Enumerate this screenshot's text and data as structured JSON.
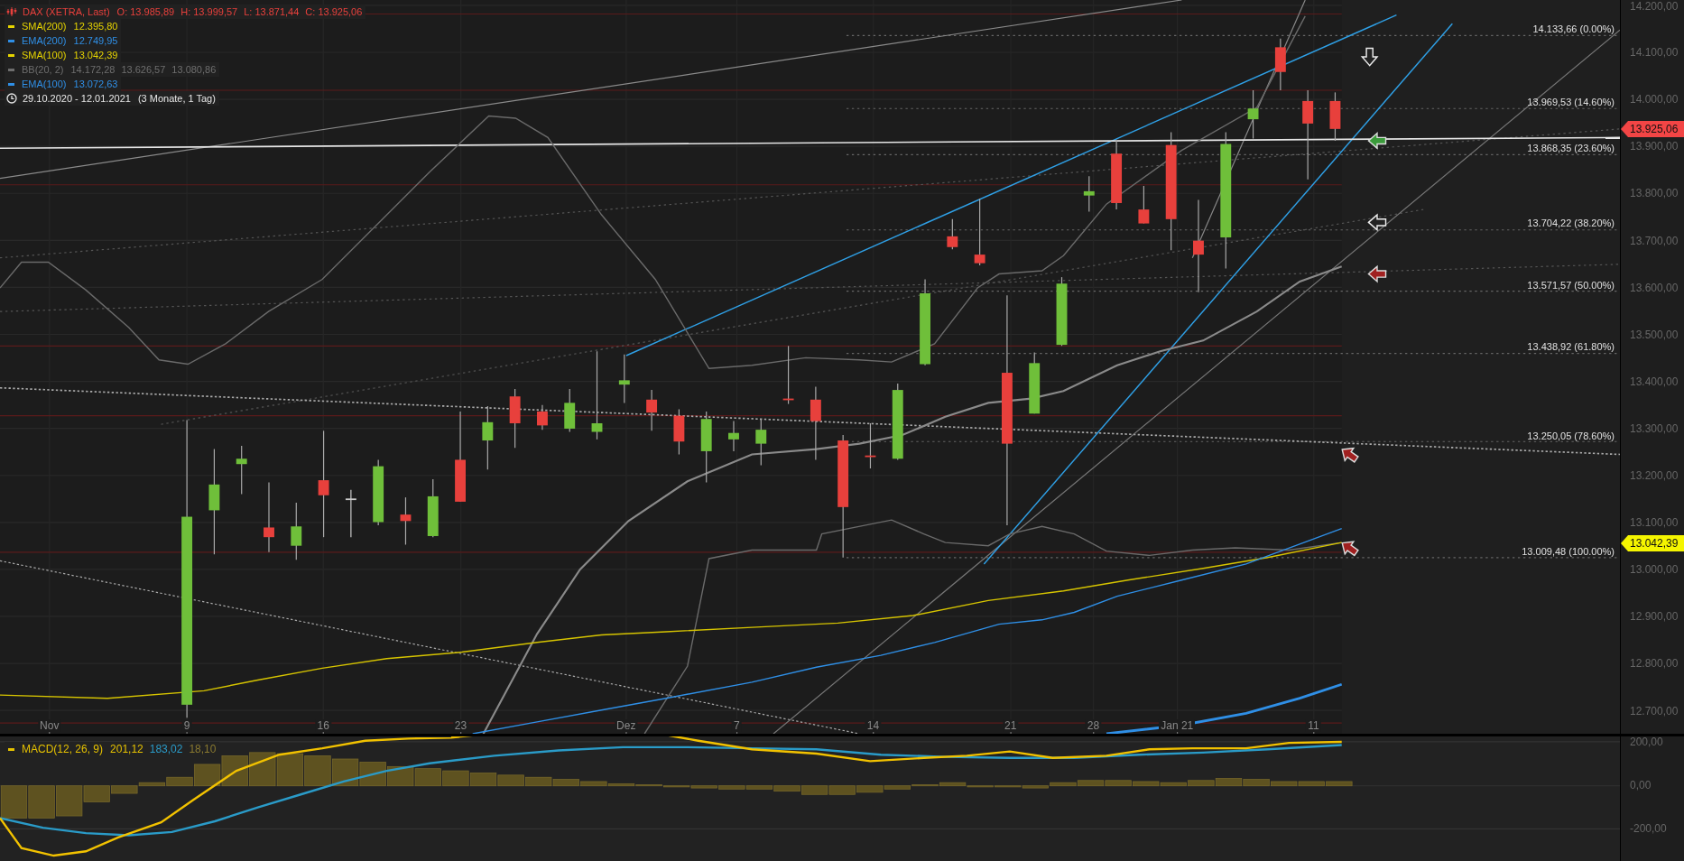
{
  "legend": [
    {
      "kind": "instrument",
      "label": "DAX (XETRA, Last)",
      "values": [
        "O: 13.985,89",
        "H: 13.999,57",
        "L: 13.871,44",
        "C: 13.925,06"
      ],
      "color": "#e8403c"
    },
    {
      "kind": "indicator",
      "label": "SMA(200)",
      "values": [
        "12.395,80"
      ],
      "color": "#e6d400"
    },
    {
      "kind": "indicator",
      "label": "EMA(200)",
      "values": [
        "12.749,95"
      ],
      "color": "#2f8fe6"
    },
    {
      "kind": "indicator",
      "label": "SMA(100)",
      "values": [
        "13.042,39"
      ],
      "color": "#e6d400"
    },
    {
      "kind": "indicator",
      "label": "BB(20, 2)",
      "values": [
        "14.172,28",
        "13.626,57",
        "13.080,86"
      ],
      "color": "#6e6e6e"
    },
    {
      "kind": "indicator",
      "label": "EMA(100)",
      "values": [
        "13.072,63"
      ],
      "color": "#2f8fe6"
    },
    {
      "kind": "range",
      "label": "29.10.2020 - 12.01.2021",
      "values": [
        "(3 Monate, 1 Tag)"
      ],
      "color": "#e6e6e6"
    }
  ],
  "fibonacci_levels": [
    "14.133,66 (0.00%)",
    "13.969,53 (14.60%)",
    "13.868,35 (23.60%)",
    "13.704,22 (38.20%)",
    "13.571,57 (50.00%)",
    "13.438,92 (61.80%)",
    "13.250,05 (78.60%)",
    "13.009,48 (100.00%)"
  ],
  "price_axis": {
    "ticks": [
      "14.200,00",
      "14.100,00",
      "14.000,00",
      "13.900,00",
      "13.800,00",
      "13.700,00",
      "13.600,00",
      "13.500,00",
      "13.400,00",
      "13.300,00",
      "13.200,00",
      "13.100,00",
      "13.000,00",
      "12.900,00",
      "12.800,00",
      "12.700,00"
    ],
    "tags": [
      {
        "label": "13.925,06",
        "color": "#f24545"
      },
      {
        "label": "13.042,39",
        "color": "#f5f500"
      }
    ]
  },
  "date_axis": [
    "Nov",
    "9",
    "16",
    "23",
    "Dez",
    "7",
    "14",
    "21",
    "28",
    "Jan 21",
    "11"
  ],
  "macd": {
    "legend": {
      "label": "MACD(12, 26, 9)",
      "color": "#e6c200",
      "values": [
        {
          "text": "201,12",
          "color": "#e6c200"
        },
        {
          "text": "183,02",
          "color": "#2a9bc8"
        },
        {
          "text": "18,10",
          "color": "#8a7a30"
        }
      ]
    },
    "axis": [
      "200,00",
      "0,00",
      "-200,00"
    ]
  }
}
